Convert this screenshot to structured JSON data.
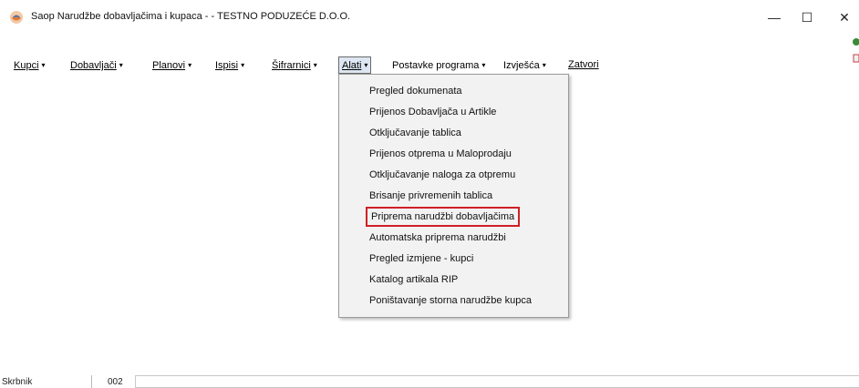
{
  "window": {
    "title": "Saop  Narudžbe dobavljačima i kupaca -  - TESTNO PODUZEĆE D.O.O.",
    "minimize_glyph": "—",
    "maximize_glyph": "☐",
    "close_glyph": "✕"
  },
  "menubar": {
    "items": [
      {
        "label": "Kupci",
        "arrow": "▾"
      },
      {
        "label": "Dobavljači",
        "arrow": "▾"
      },
      {
        "label": "Planovi",
        "arrow": "▾"
      },
      {
        "label": "Ispisi",
        "arrow": "▾"
      },
      {
        "label": "Šifrarnici",
        "arrow": "▾"
      },
      {
        "label": "Alati",
        "arrow": "▾"
      },
      {
        "label": "Postavke programa",
        "arrow": "▾"
      },
      {
        "label": "Izvješća",
        "arrow": "▾"
      },
      {
        "label": "Zatvori",
        "arrow": ""
      }
    ]
  },
  "dropdown": {
    "items": [
      "Pregled dokumenata",
      "Prijenos Dobavljača u Artikle",
      "Otključavanje tablica",
      "Prijenos otprema u Maloprodaju",
      "Otključavanje naloga za otpremu",
      "Brisanje privremenih tablica",
      "Priprema narudžbi dobavljačima",
      "Automatska priprema narudžbi",
      "Pregled izmjene - kupci",
      "Katalog artikala RIP",
      "Poništavanje storna narudžbe kupca"
    ]
  },
  "statusbar": {
    "user": "Skrbnik",
    "code": "002"
  },
  "colors": {
    "highlight_border": "#d01f25",
    "menu_active_bg": "#dde6f2",
    "dropdown_bg": "#f2f2f2"
  },
  "icons": {
    "app": "saop-app-icon",
    "side": "side-toolbar-icons"
  }
}
